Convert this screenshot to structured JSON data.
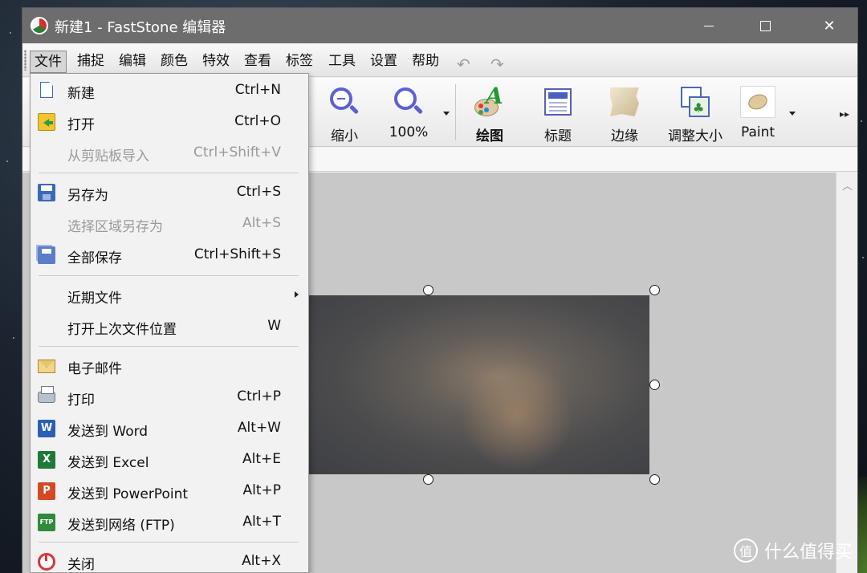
{
  "window": {
    "title": "新建1 - FastStone 编辑器"
  },
  "menubar": {
    "items": [
      "文件",
      "捕捉",
      "编辑",
      "颜色",
      "特效",
      "查看",
      "标签",
      "工具",
      "设置",
      "帮助"
    ],
    "active": "文件"
  },
  "toolbar": {
    "zoom_out_label": "缩小",
    "zoom_label": "100%",
    "draw_label": "绘图",
    "caption_label": "标题",
    "edge_label": "边缘",
    "resize_label": "调整大小",
    "paint_label": "Paint"
  },
  "file_menu": {
    "items": [
      {
        "label": "新建",
        "shortcut": "Ctrl+N",
        "icon": "new-file-icon",
        "enabled": true
      },
      {
        "label": "打开",
        "shortcut": "Ctrl+O",
        "icon": "open-folder-icon",
        "enabled": true
      },
      {
        "label": "从剪贴板导入",
        "shortcut": "Ctrl+Shift+V",
        "enabled": false
      },
      {
        "label": "另存为",
        "shortcut": "Ctrl+S",
        "icon": "save-icon",
        "enabled": true
      },
      {
        "label": "选择区域另存为",
        "shortcut": "Alt+S",
        "enabled": false
      },
      {
        "label": "全部保存",
        "shortcut": "Ctrl+Shift+S",
        "icon": "save-all-icon",
        "enabled": true
      },
      {
        "label": "近期文件",
        "shortcut": "",
        "submenu": true,
        "enabled": true
      },
      {
        "label": "打开上次文件位置",
        "shortcut": "W",
        "enabled": true
      },
      {
        "label": "电子邮件",
        "shortcut": "",
        "icon": "email-icon",
        "enabled": true
      },
      {
        "label": "打印",
        "shortcut": "Ctrl+P",
        "icon": "printer-icon",
        "enabled": true
      },
      {
        "label": "发送到 Word",
        "shortcut": "Alt+W",
        "icon": "word-icon",
        "enabled": true
      },
      {
        "label": "发送到 Excel",
        "shortcut": "Alt+E",
        "icon": "excel-icon",
        "enabled": true
      },
      {
        "label": "发送到 PowerPoint",
        "shortcut": "Alt+P",
        "icon": "powerpoint-icon",
        "enabled": true
      },
      {
        "label": "发送到网络 (FTP)",
        "shortcut": "Alt+T",
        "icon": "ftp-icon",
        "enabled": true
      },
      {
        "label": "关闭",
        "shortcut": "Alt+X",
        "icon": "power-icon",
        "enabled": true
      }
    ]
  },
  "icon_glyphs": {
    "word": "W",
    "excel": "X",
    "powerpoint": "P",
    "ftp": "FTP"
  },
  "watermark": {
    "text": "什么值得买",
    "mark": "值"
  },
  "colors": {
    "titlebar": "#6d6d6d",
    "canvas": "#c8c8c8",
    "zoom_icon": "#5e5fd6",
    "disabled_text": "#9a9a9a"
  }
}
